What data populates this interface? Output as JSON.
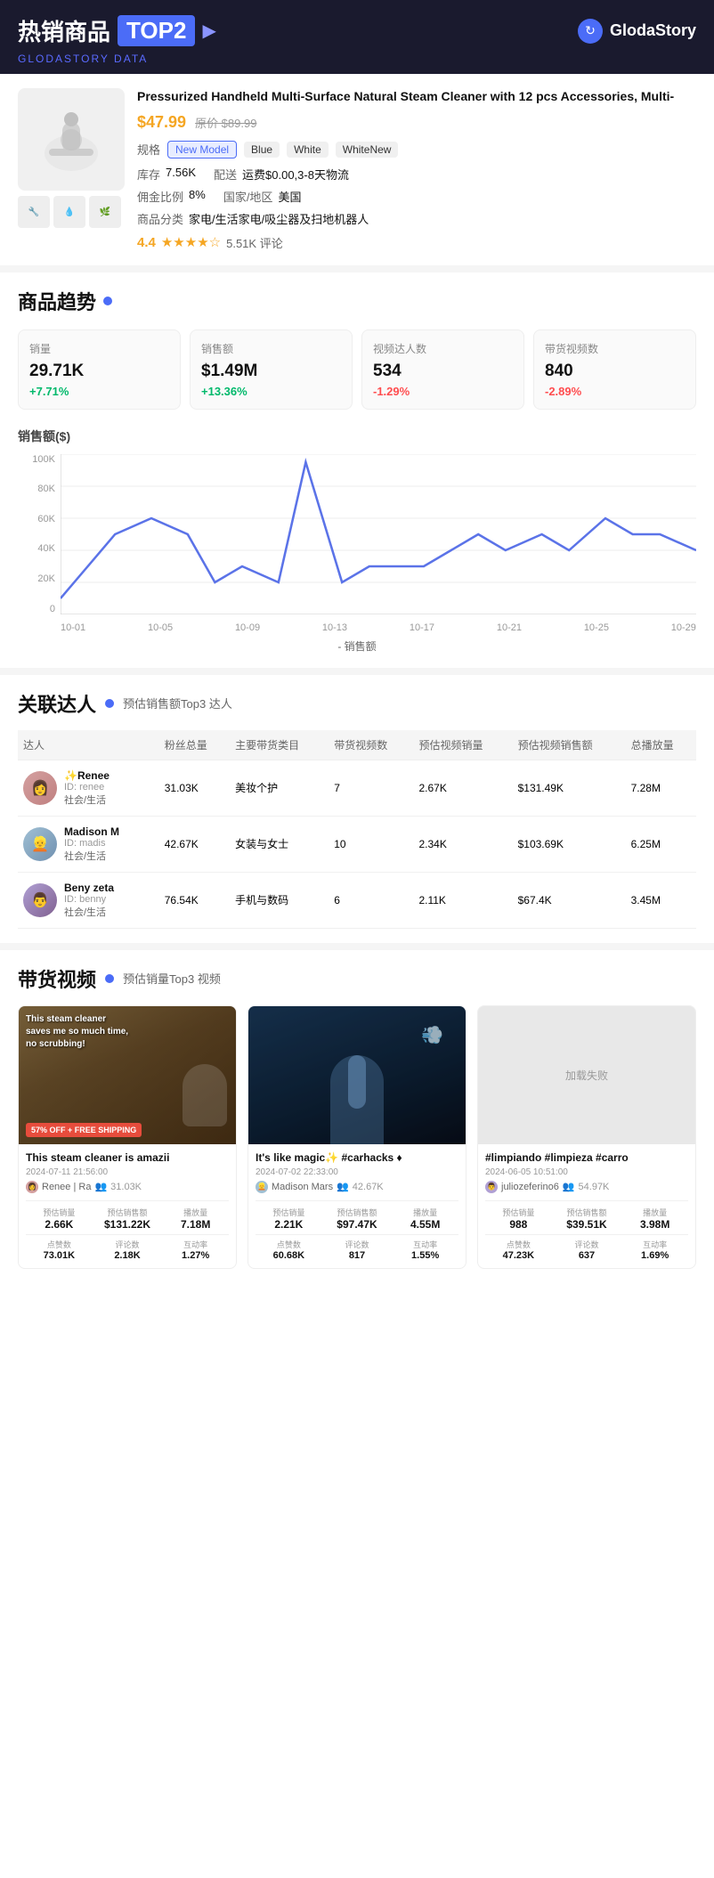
{
  "header": {
    "title_zh": "热销商品",
    "top_badge": "TOP2",
    "arrow": "▶",
    "brand": "GlodaStory",
    "subtitle": "GLODASTORY DATA"
  },
  "product": {
    "title": "Pressurized Handheld Multi-Surface Natural Steam Cleaner with 12 pcs Accessories, Multi-",
    "price_current": "$47.99",
    "price_original": "原价 $89.99",
    "spec_label": "规格",
    "spec_tags": [
      "New Model",
      "Blue",
      "White",
      "WhiteNew"
    ],
    "stock_label": "库存",
    "stock_value": "7.56K",
    "shipping_label": "配送",
    "shipping_value": "运费$0.00,3-8天物流",
    "commission_label": "佣金比例",
    "commission_value": "8%",
    "region_label": "国家/地区",
    "region_value": "美国",
    "category_label": "商品分类",
    "category_value": "家电/生活家电/吸尘器及扫地机器人",
    "rating": "4.4",
    "reviews_label": "评论",
    "reviews_count": "5.51K"
  },
  "trend": {
    "section_title": "商品趋势",
    "metrics": [
      {
        "label": "销量",
        "value": "29.71K",
        "change": "+7.71%",
        "positive": true
      },
      {
        "label": "销售额",
        "value": "$1.49M",
        "change": "+13.36%",
        "positive": true
      },
      {
        "label": "视频达人数",
        "value": "534",
        "change": "-1.29%",
        "positive": false
      },
      {
        "label": "带货视频数",
        "value": "840",
        "change": "-2.89%",
        "positive": false
      }
    ],
    "chart_title": "销售额($)",
    "y_labels": [
      "100K",
      "80K",
      "60K",
      "40K",
      "20K",
      "0"
    ],
    "x_labels": [
      "10-01",
      "10-05",
      "10-09",
      "10-13",
      "10-17",
      "10-21",
      "10-25",
      "10-29"
    ],
    "chart_legend": "- 销售额"
  },
  "influencers": {
    "section_title": "关联达人",
    "subtitle": "预估销售额Top3 达人",
    "columns": [
      "达人",
      "粉丝总量",
      "主要带货类目",
      "带货视频数",
      "预估视频销量",
      "预估视频销售额",
      "总播放量"
    ],
    "rows": [
      {
        "name": "✨Renee",
        "id": "ID: renee",
        "category": "社会/生活",
        "followers": "31.03K",
        "main_category": "美妆个护",
        "videos": "7",
        "est_sales": "2.67K",
        "est_revenue": "$131.49K",
        "total_views": "7.28M"
      },
      {
        "name": "Madison M",
        "id": "ID: madis",
        "category": "社会/生活",
        "followers": "42.67K",
        "main_category": "女装与女士",
        "videos": "10",
        "est_sales": "2.34K",
        "est_revenue": "$103.69K",
        "total_views": "6.25M"
      },
      {
        "name": "Beny zeta",
        "id": "ID: benny",
        "category": "社会/生活",
        "followers": "76.54K",
        "main_category": "手机与数码",
        "videos": "6",
        "est_sales": "2.11K",
        "est_revenue": "$67.4K",
        "total_views": "3.45M"
      }
    ]
  },
  "videos": {
    "section_title": "带货视频",
    "subtitle": "预估销量Top3 视频",
    "items": [
      {
        "title": "This steam cleaner is amazii",
        "date": "2024-07-11 21:56:00",
        "author": "Renee | Ra",
        "followers": "31.03K",
        "overlay_text": "This steam cleaner saves me so much time, no scrubbing!",
        "badge": "57% OFF + FREE SHIPPING",
        "est_sales_label": "预估销量",
        "est_sales": "2.66K",
        "est_revenue_label": "预估销售额",
        "est_revenue": "$131.22K",
        "views_label": "播放量",
        "views": "7.18M",
        "likes_label": "点赞数",
        "likes": "73.01K",
        "comments_label": "评论数",
        "comments": "2.18K",
        "engagement_label": "互动率",
        "engagement": "1.27%"
      },
      {
        "title": "It's like magic✨ #carhacks ♦",
        "date": "2024-07-02 22:33:00",
        "author": "Madison Mars",
        "followers": "42.67K",
        "overlay_text": "",
        "badge": "",
        "est_sales_label": "预估销量",
        "est_sales": "2.21K",
        "est_revenue_label": "预估销售额",
        "est_revenue": "$97.47K",
        "views_label": "播放量",
        "views": "4.55M",
        "likes_label": "点赞数",
        "likes": "60.68K",
        "comments_label": "评论数",
        "comments": "817",
        "engagement_label": "互动率",
        "engagement": "1.55%"
      },
      {
        "title": "#limpiando #limpieza #carro",
        "date": "2024-06-05 10:51:00",
        "author": "juliozeferino6",
        "followers": "54.97K",
        "overlay_text": "",
        "badge": "",
        "load_fail": "加载失败",
        "est_sales_label": "预估销量",
        "est_sales": "988",
        "est_revenue_label": "预估销售额",
        "est_revenue": "$39.51K",
        "views_label": "播放量",
        "views": "3.98M",
        "likes_label": "点赞数",
        "likes": "47.23K",
        "comments_label": "评论数",
        "comments": "637",
        "engagement_label": "互动率",
        "engagement": "1.69%"
      }
    ]
  }
}
